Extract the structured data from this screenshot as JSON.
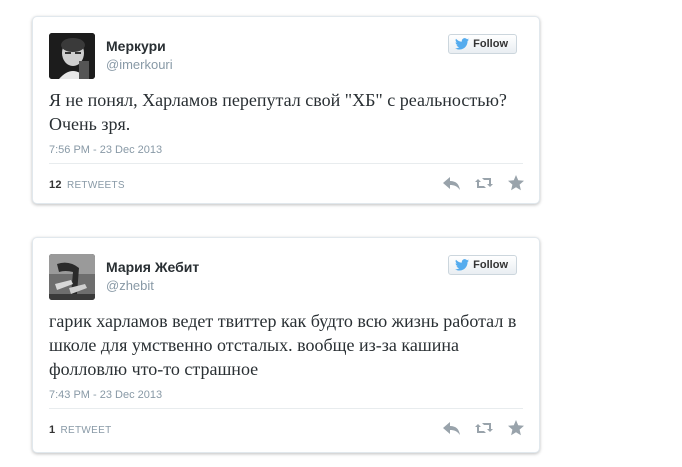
{
  "colors": {
    "twitter_blue": "#55acee",
    "text": "#292f33",
    "muted": "#8899a6",
    "icon": "#99a3ab"
  },
  "tweets": [
    {
      "name": "Меркури",
      "handle": "@imerkouri",
      "follow_label": "Follow",
      "text": "Я не понял, Харламов перепутал свой \"ХБ\" с реальностью? Очень зря.",
      "timestamp": "7:56 PM - 23 Dec 2013",
      "retweet_count": "12",
      "retweet_label": "RETWEETS",
      "avatar": "monochrome-portrait"
    },
    {
      "name": "Мария Жебит",
      "handle": "@zhebit",
      "follow_label": "Follow",
      "text": "гарик харламов ведет твиттер как будто всю жизнь работал в школе для умственно отсталых. вообще из-за кашина фолловлю что-то страшное",
      "timestamp": "7:43 PM - 23 Dec 2013",
      "retweet_count": "1",
      "retweet_label": "RETWEET",
      "avatar": "monochrome-legs-photo"
    }
  ],
  "icons": {
    "follow": "twitter-bird-icon",
    "reply": "reply-icon",
    "retweet": "retweet-icon",
    "favorite": "star-icon"
  }
}
